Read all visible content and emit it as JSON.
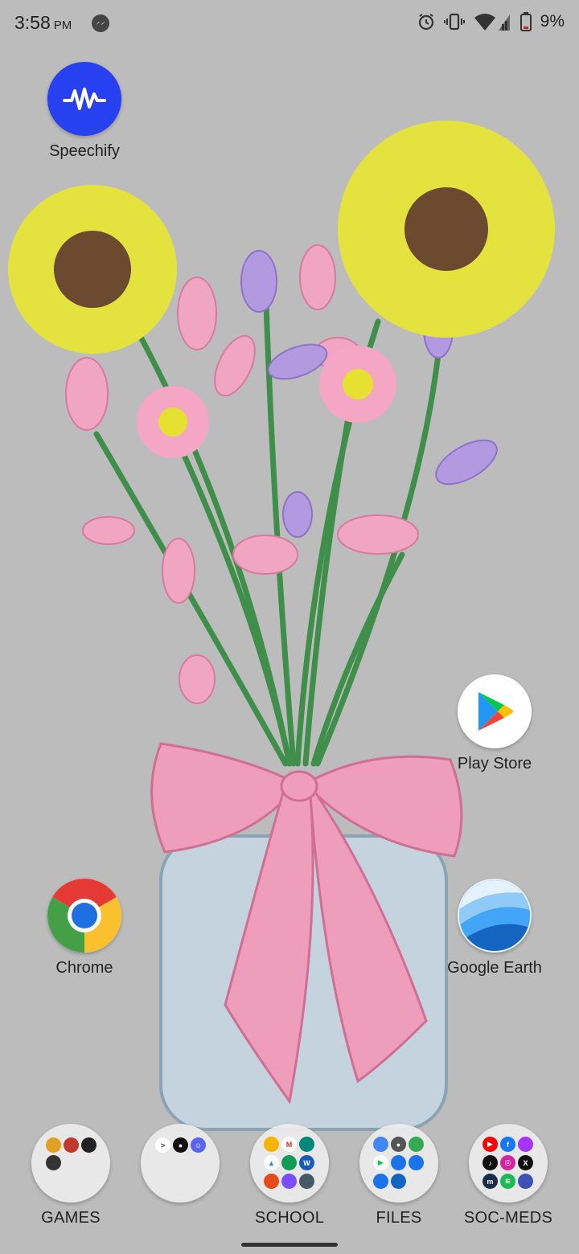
{
  "status_bar": {
    "time": "3:58",
    "ampm": "PM",
    "battery_percent": "9%",
    "icons": [
      "messenger-icon",
      "alarm-icon",
      "vibrate-icon",
      "wifi-icon",
      "signal-icon",
      "battery-icon"
    ]
  },
  "apps": {
    "speechify": {
      "label": "Speechify",
      "icon": "speechify-icon",
      "color": "#2740f0"
    },
    "play_store": {
      "label": "Play Store",
      "icon": "play-store-icon"
    },
    "chrome": {
      "label": "Chrome",
      "icon": "chrome-icon"
    },
    "google_earth": {
      "label": "Google Earth",
      "icon": "google-earth-icon"
    }
  },
  "dock": {
    "folders": [
      {
        "label": "GAMES",
        "icons": [
          "game-1-icon",
          "game-2-icon",
          "game-3-icon",
          "game-4-icon"
        ]
      },
      {
        "label": "",
        "icons": [
          "terminal-icon",
          "github-icon",
          "discord-icon"
        ]
      },
      {
        "label": "SCHOOL",
        "icons": [
          "slides-icon",
          "gmail-icon",
          "meet-icon",
          "drive-icon",
          "classroom-icon",
          "word-icon",
          "office-icon",
          "canva-icon",
          "app-icon"
        ]
      },
      {
        "label": "FILES",
        "icons": [
          "photos-icon",
          "camera-icon",
          "files-icon",
          "play-icon",
          "phone-icon",
          "messages-icon",
          "contacts-icon",
          "share-icon"
        ]
      },
      {
        "label": "SOC-MEDS",
        "icons": [
          "youtube-icon",
          "facebook-icon",
          "messenger-icon",
          "tiktok-icon",
          "instagram-icon",
          "x-icon",
          "m-icon",
          "spotify-icon",
          "vpn-icon"
        ]
      }
    ]
  }
}
